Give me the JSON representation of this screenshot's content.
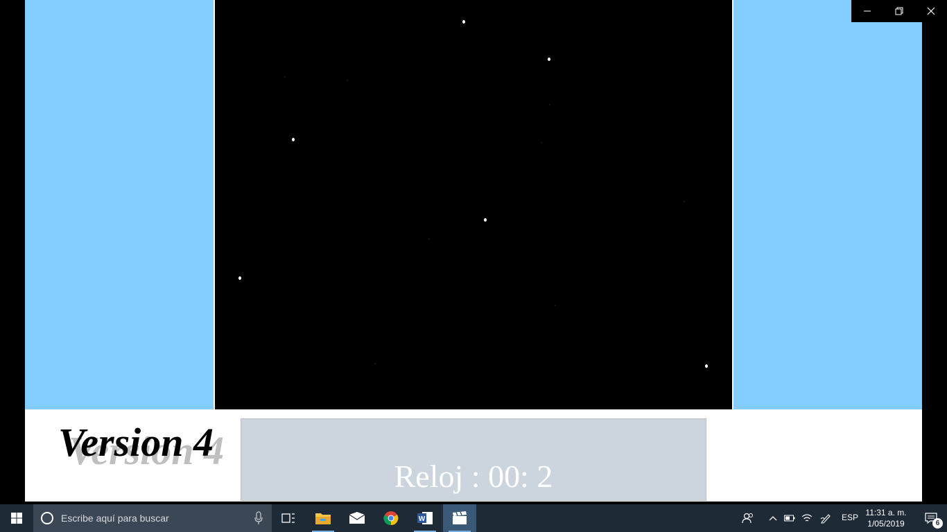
{
  "app": {
    "version_label": "Version 4",
    "clock_text": "Reloj : 00: 2"
  },
  "window_controls": {
    "icons": [
      "minimize-icon",
      "restore-icon",
      "close-icon"
    ]
  },
  "taskbar": {
    "search_placeholder": "Escribe aquí para buscar",
    "language": "ESP",
    "time": "11:31 a. m.",
    "date": "1/05/2019",
    "notification_count": "6"
  },
  "colors": {
    "side_panel": "#82cdfd",
    "clock_panel": "#ccd4dd",
    "taskbar": "#1f2a37"
  }
}
